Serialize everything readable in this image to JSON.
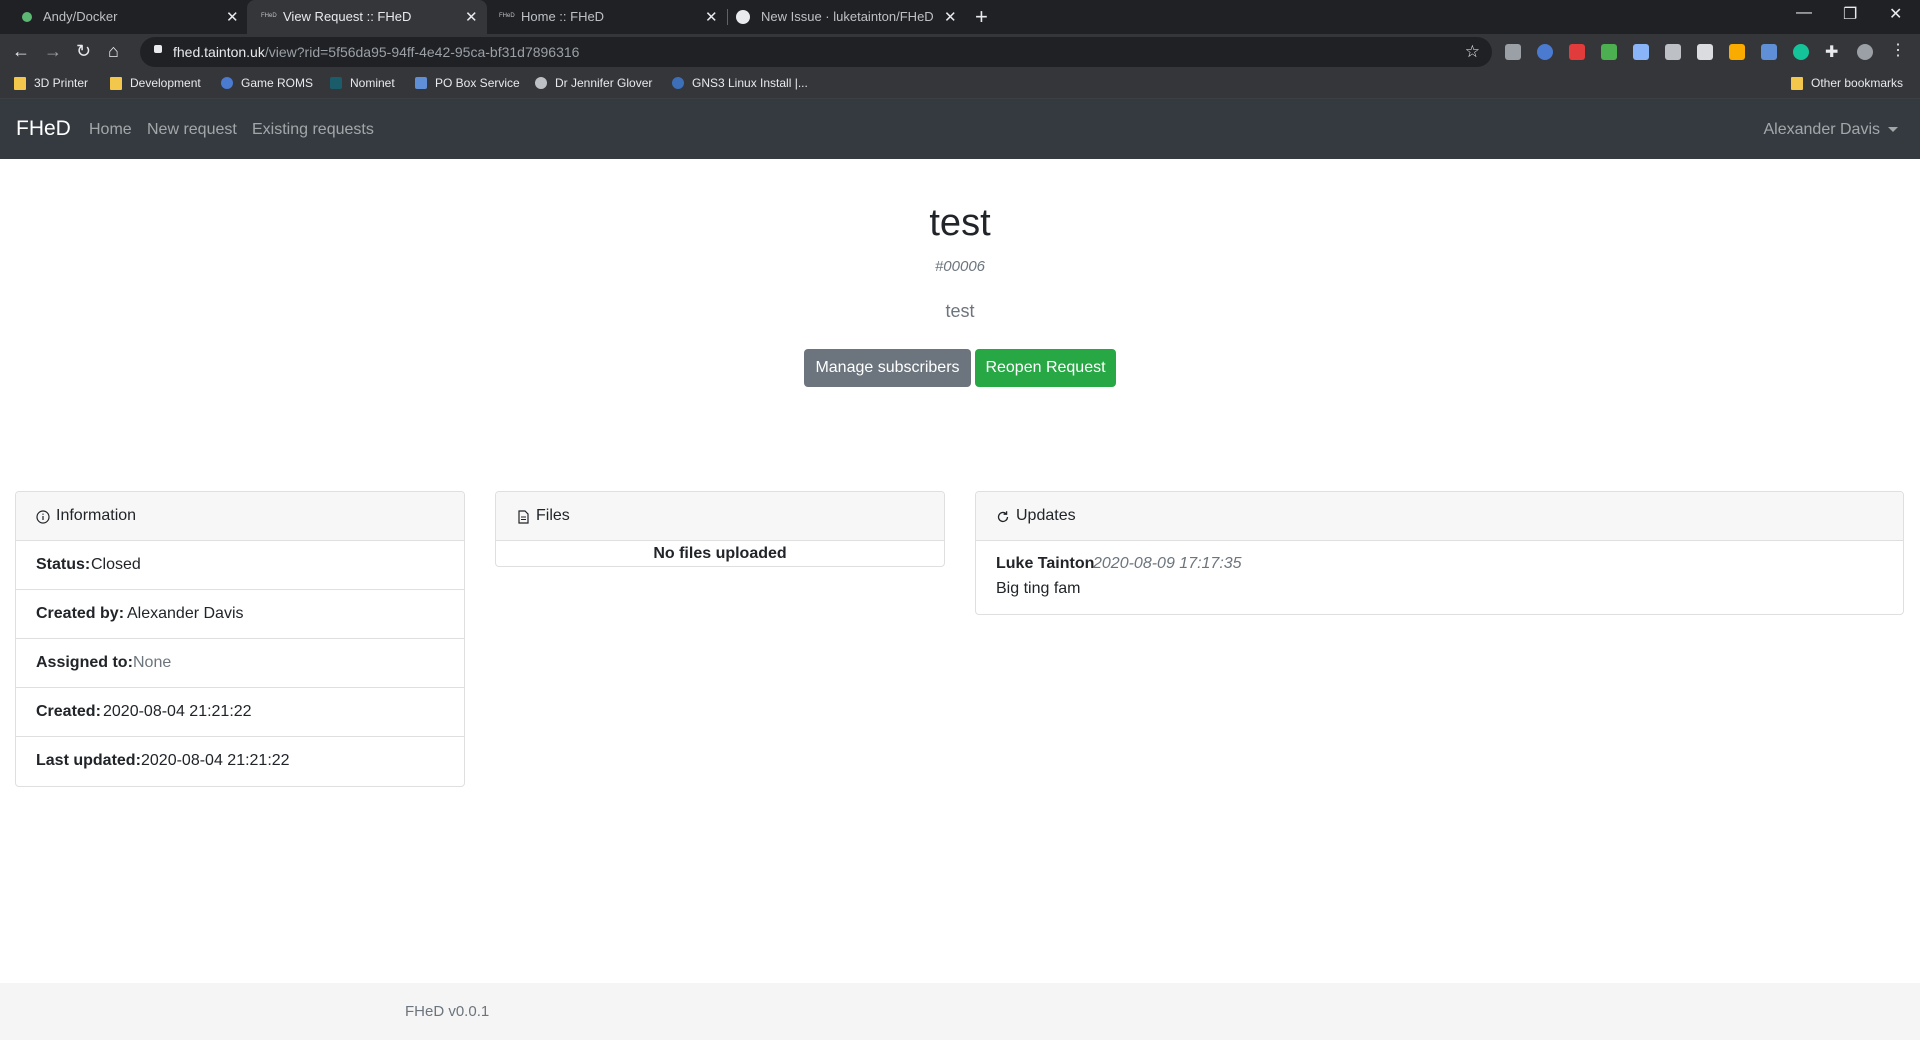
{
  "browser": {
    "tabs": [
      {
        "title": "Andy/Docker",
        "favicon": "green-dot-icon"
      },
      {
        "title": "View Request :: FHeD",
        "favicon": "fhed-favicon-icon",
        "active": true
      },
      {
        "title": "Home :: FHeD",
        "favicon": "fhed-favicon-icon"
      },
      {
        "title": "New Issue · luketainton/FHeD",
        "favicon": "github-icon"
      }
    ],
    "url_host": "fhed.tainton.uk",
    "url_path": "/view?rid=5f56da95-94ff-4e42-95ca-bf31d7896316",
    "bookmarks": [
      {
        "label": "3D Printer",
        "icon": "folder-icon"
      },
      {
        "label": "Development",
        "icon": "folder-icon"
      },
      {
        "label": "Game ROMS",
        "icon": "site-icon"
      },
      {
        "label": "Nominet",
        "icon": "site-icon"
      },
      {
        "label": "PO Box Service",
        "icon": "site-icon"
      },
      {
        "label": "Dr Jennifer Glover",
        "icon": "wordpress-icon"
      },
      {
        "label": "GNS3 Linux Install |...",
        "icon": "site-icon"
      }
    ],
    "other_bookmarks": "Other bookmarks"
  },
  "navbar": {
    "brand": "FHeD",
    "links": [
      "Home",
      "New request",
      "Existing requests"
    ],
    "user": "Alexander Davis"
  },
  "request": {
    "title": "test",
    "id": "#00006",
    "description": "test",
    "manage_label": "Manage subscribers",
    "reopen_label": "Reopen Request"
  },
  "info": {
    "header": "Information",
    "status_label": "Status:",
    "status": "Closed",
    "created_by_label": "Created by:",
    "created_by": "Alexander Davis",
    "assigned_label": "Assigned to:",
    "assigned": "None",
    "created_label": "Created:",
    "created": "2020-08-04 21:21:22",
    "updated_label": "Last updated:",
    "updated": "2020-08-04 21:21:22"
  },
  "files": {
    "header": "Files",
    "empty": "No files uploaded"
  },
  "updates": {
    "header": "Updates",
    "items": [
      {
        "author": "Luke Tainton",
        "time": "2020-08-09 17:17:35",
        "message": "Big ting fam"
      }
    ]
  },
  "footer": {
    "version": "FHeD v0.0.1"
  },
  "colors": {
    "navbar": "#343a40",
    "success": "#28a745",
    "secondary": "#6c757d"
  }
}
